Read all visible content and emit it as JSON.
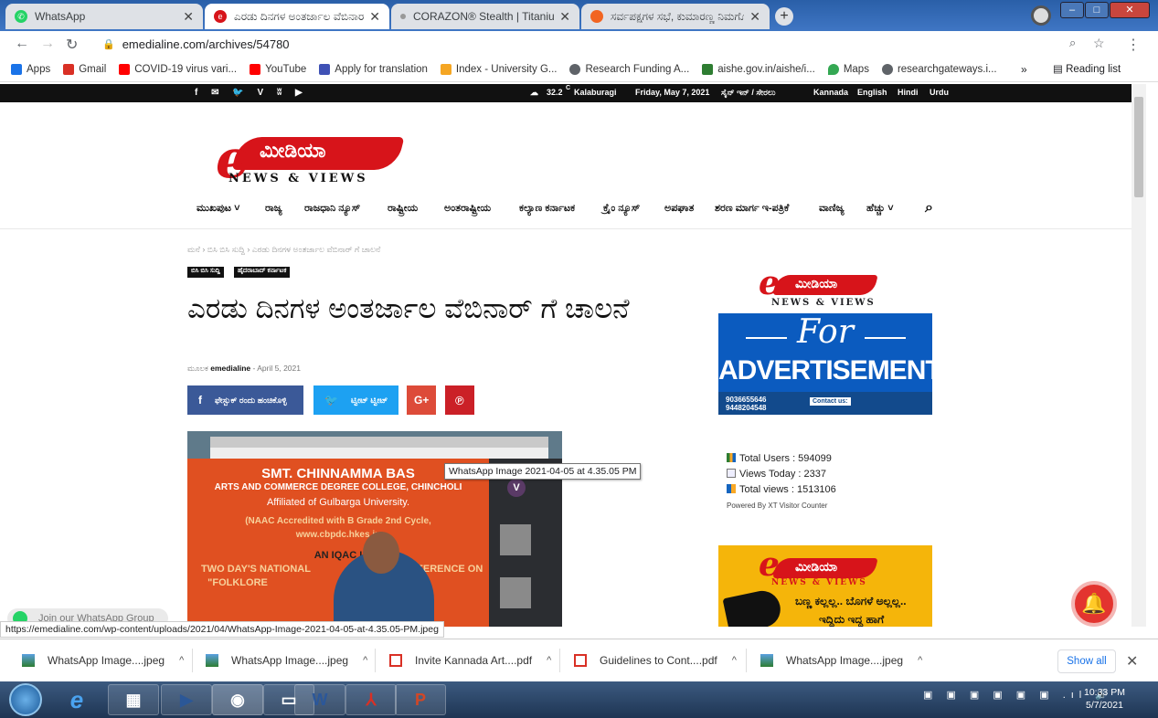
{
  "browser": {
    "tabs": [
      {
        "title": "WhatsApp",
        "favicon": "whatsapp-icon",
        "color": "#25d366"
      },
      {
        "title": "ಎರಡು ದಿನಗಳ ಅಂತರ್ಜಾಲ ವೆಬಿನಾರ್ ಗೆ",
        "favicon": "emedialine-icon",
        "color": "#d7141a"
      },
      {
        "title": "CORAZON® Stealth | Titanium M",
        "favicon": "dot-icon",
        "color": "#999999"
      },
      {
        "title": "ಸರ್ವಪಕ್ಷಗಳ ಸಭೆ, ಕುಮಾರಣ್ಣ ನಿಮಗೊಂ",
        "favicon": "orange-icon",
        "color": "#f26522"
      }
    ],
    "url": "emedialine.com/archives/54780",
    "profile_initial": "m",
    "bookmarks": [
      {
        "label": "Apps",
        "color": "#1a73e8"
      },
      {
        "label": "Gmail",
        "color": "#d93025"
      },
      {
        "label": "COVID-19 virus vari...",
        "color": "#ff0000"
      },
      {
        "label": "YouTube",
        "color": "#ff0000"
      },
      {
        "label": "Apply for translation",
        "color": "#3f51b5"
      },
      {
        "label": "Index - University G...",
        "color": "#f5a623"
      },
      {
        "label": "Research Funding A...",
        "color": "#5f6368"
      },
      {
        "label": "aishe.gov.in/aishe/i...",
        "color": "#2e7d32"
      },
      {
        "label": "Maps",
        "color": "#34a853"
      },
      {
        "label": "researchgateways.i...",
        "color": "#5f6368"
      }
    ],
    "reading_list": "Reading list",
    "more_bookmarks": "»"
  },
  "site": {
    "topbar": {
      "social": "f  ✉  🐦  V  ʬ  ▶",
      "temperature": "32.2",
      "temp_unit": "C",
      "city": "Kalaburagi",
      "date": "Friday, May 7, 2021",
      "auth": "ಸೈನ್ ಇನ್ / ಸೇರಲು",
      "languages": [
        "Kannada",
        "English",
        "Hindi",
        "Urdu"
      ]
    },
    "logo": {
      "text": "ಮೀಡಿಯಾ",
      "tagline": "NEWS & VIEWS",
      "letter": "e"
    },
    "nav": [
      "ಮುಖಪುಟ ˅",
      "ರಾಜ್ಯ",
      "ರಾಜಧಾನಿ ನ್ಯೂಸ್",
      "ರಾಷ್ಟ್ರೀಯ",
      "ಅಂತರಾಷ್ಟ್ರೀಯ",
      "ಕಲ್ಯಾಣ ಕರ್ನಾಟಕ",
      "ಕ್ರೈಂ ನ್ಯೂಸ್",
      "ಅಪಘಾತ",
      "ಶರಣ ಮಾರ್ಗ ಇ-ಪತ್ರಿಕೆ",
      "ವಾಣಿಜ್ಯ",
      "ಹೆಚ್ಚು ˅"
    ]
  },
  "article": {
    "breadcrumb": "ಮನೆ › ಬಿಸಿ ಬಿಸಿ ಸುದ್ದಿ › ಎರಡು ದಿನಗಳ ಅಂತರ್ಜಾಲ ವೆಬಿನಾರ್ ಗೆ ಚಾಲನೆ",
    "tags": [
      "ಬಿಸಿ ಬಿಸಿ ಸುದ್ದಿ",
      "ಹೈದರಾಬಾದ್ ಕರ್ನಾಟಕ"
    ],
    "title": "ಎರಡು ದಿನಗಳ ಅಂತರ್ಜಾಲ ವೆಬಿನಾರ್ ಗೆ ಚಾಲನೆ",
    "by_label": "ಮೂಲಕ",
    "author": "emedialine",
    "date": "April 5, 2021",
    "share": {
      "facebook": "ಫೇಸ್ಬುಕ್ ರಂದು ಹಂಚಿಕೊಳ್ಳಿ",
      "twitter": "ಟ್ವೀಟ್ ಟ್ವೀಟ್"
    },
    "image": {
      "slide_lines": [
        "SMT. CHINNAMMA BAS",
        "ARTS AND COMMERCE DEGREE COLLEGE, CHINCHOLI",
        "Affiliated of Gulbarga University.",
        "(NAAC Accredited with B Grade 2nd Cycle,",
        "www.cbpdc.hkes.in",
        "AN IQAC I",
        "TWO DAY'S NATIONAL",
        "CONFERENCE ON",
        "\"FOLKLORE"
      ],
      "participant_initial": "V",
      "tooltip": "WhatsApp Image 2021-04-05 at 4.35.05 PM"
    }
  },
  "sidebar": {
    "ad1": {
      "tagline": "NEWS & VIEWS",
      "for": "For",
      "advertisement": "ADVERTISEMENT",
      "phones": "9036655646\n9448204548",
      "contact": "Contact us:"
    },
    "stats": {
      "total_users_label": "Total Users : 594099",
      "views_today_label": "Views Today : 2337",
      "total_views_label": "Total views : 1513106",
      "powered_by": "Powered By XT Visitor Counter"
    },
    "ad2": {
      "tagline": "NEWS & VIEWS",
      "line1": "ಬಣ್ಣ ಕಲ್ಲಲ್ಲ.. ಬೊಗಳೆ ಅಲ್ಲಲ್ಲ..",
      "line2": "ಇದ್ದಿದು ಇದ್ದ ಹಾಗೆ"
    }
  },
  "whatsapp_chip": "Join our WhatsApp Group",
  "status_url": "https://emedialine.com/wp-content/uploads/2021/04/WhatsApp-Image-2021-04-05-at-4.35.05-PM.jpeg",
  "downloads": {
    "items": [
      {
        "name": "WhatsApp Image....jpeg",
        "type": "image"
      },
      {
        "name": "WhatsApp Image....jpeg",
        "type": "image"
      },
      {
        "name": "Invite Kannada Art....pdf",
        "type": "pdf"
      },
      {
        "name": "Guidelines to Cont....pdf",
        "type": "pdf"
      },
      {
        "name": "WhatsApp Image....jpeg",
        "type": "image"
      }
    ],
    "show_all": "Show all"
  },
  "taskbar": {
    "time": "10:33 PM",
    "date": "5/7/2021"
  },
  "colors": {
    "brand_red": "#d7141a",
    "facebook": "#3b5998",
    "twitter": "#1da1f2",
    "google": "#dd4b39",
    "pinterest": "#cb2027"
  }
}
